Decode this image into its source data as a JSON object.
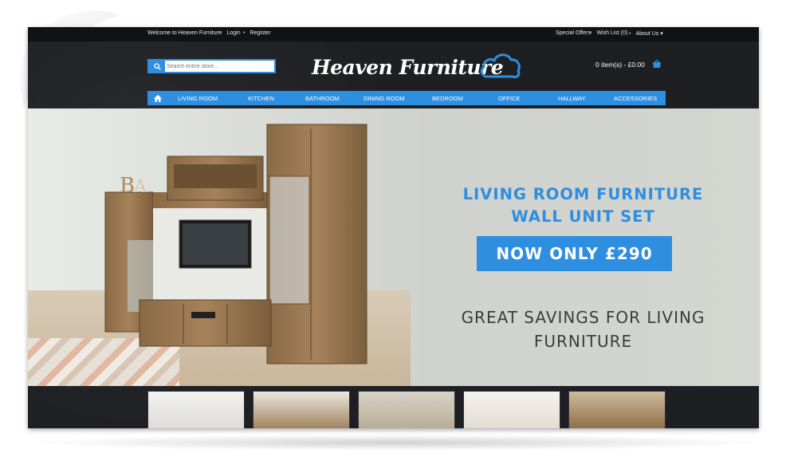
{
  "topbar": {
    "welcome": "Welcome to Heaven Furniture",
    "login": "Login",
    "register": "Register",
    "special_offers": "Special Offers",
    "wish_list": "Wish List (0)",
    "about_us": "About Us"
  },
  "search": {
    "placeholder": "Search entire store..."
  },
  "logo": {
    "text": "Heaven Furniture"
  },
  "cart": {
    "summary": "0 item(s) - £0.00"
  },
  "nav": {
    "items": [
      "LIVING ROOM",
      "KITCHEN",
      "BATHROOM",
      "DINING ROOM",
      "BEDROOM",
      "OFFICE",
      "HALLWAY",
      "ACCESSORIES"
    ]
  },
  "hero": {
    "title_line1": "LIVING ROOM FURNITURE",
    "title_line2": "WALL UNIT SET",
    "price": "NOW ONLY £290",
    "sub_line1": "GREAT SAVINGS FOR LIVING",
    "sub_line2": "FURNITURE"
  },
  "colors": {
    "accent": "#2e8ee0",
    "dark_bg": "#1e1f22",
    "hero_bg": "#d9dcd7"
  },
  "icons": [
    "search-icon",
    "home-icon",
    "cart-icon",
    "cloud-icon",
    "chevron-down-icon"
  ]
}
